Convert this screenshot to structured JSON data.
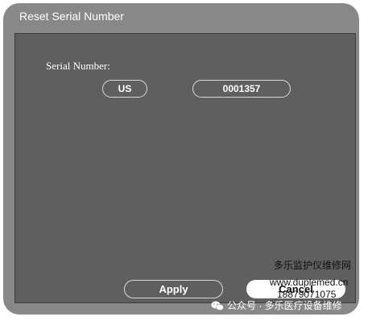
{
  "dialog": {
    "title": "Reset Serial Number",
    "serial_label": "Serial Number:",
    "prefix_value": "US",
    "number_value": "0001357",
    "apply_label": "Apply",
    "cancel_label": "Cancel"
  },
  "watermark": {
    "line1": "多乐监护仪维修网",
    "line2": "www.duplemed.cn",
    "line3": "18879071075",
    "line4": "公众号 · 多乐医疗设备维修",
    "icon": "wechat-icon"
  },
  "colors": {
    "window_frame": "#888888",
    "panel": "#5f5f5f",
    "text": "#ffffff"
  }
}
